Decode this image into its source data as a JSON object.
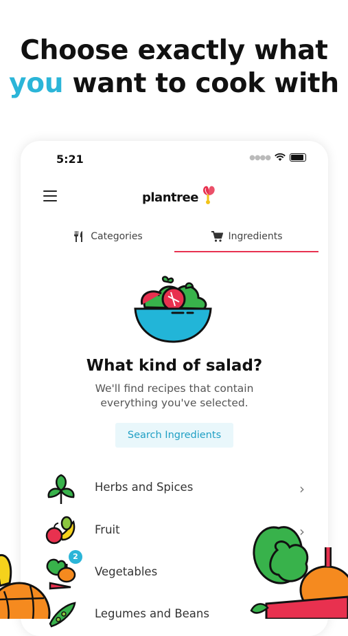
{
  "headline": {
    "line1": "Choose exactly what",
    "accent": "you",
    "line2_rest": " want to cook with"
  },
  "status_bar": {
    "time": "5:21"
  },
  "header": {
    "logo_text": "plantree"
  },
  "tabs": [
    {
      "label": "Categories",
      "icon": "fork-knife-icon",
      "active": false
    },
    {
      "label": "Ingredients",
      "icon": "cart-icon",
      "active": true
    }
  ],
  "empty_state": {
    "title": "What kind of salad?",
    "subtitle": "We'll find recipes that contain everything you've selected.",
    "button_label": "Search Ingredients"
  },
  "ingredient_categories": [
    {
      "label": "Herbs and Spices",
      "icon": "herbs-icon",
      "badge": ""
    },
    {
      "label": "Fruit",
      "icon": "fruit-icon",
      "badge": ""
    },
    {
      "label": "Vegetables",
      "icon": "vegetables-icon",
      "badge": "2"
    },
    {
      "label": "Legumes and Beans",
      "icon": "legumes-icon",
      "badge": ""
    }
  ],
  "colors": {
    "accent": "#2bb5d8",
    "tab_indicator": "#e8314f",
    "button_bg": "#e9f7fb"
  }
}
